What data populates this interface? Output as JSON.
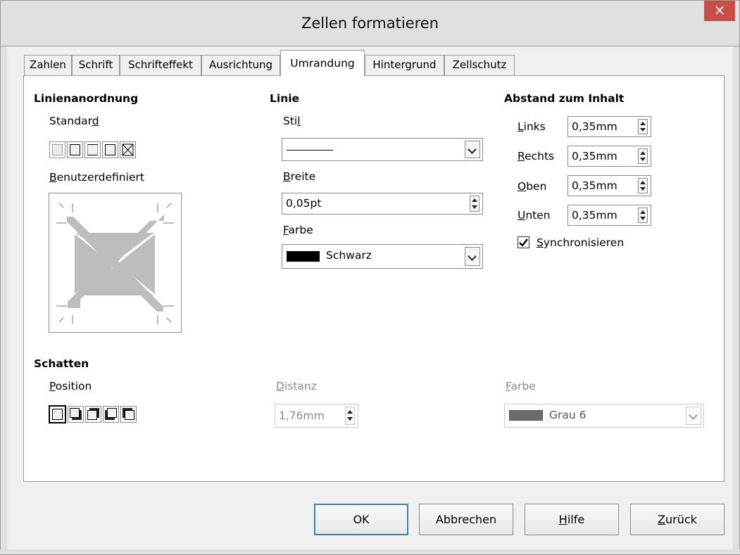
{
  "window": {
    "title": "Zellen formatieren",
    "close_glyph": "×"
  },
  "tabs": [
    {
      "label": "Zahlen",
      "active": false
    },
    {
      "label": "Schrift",
      "active": false
    },
    {
      "label": "Schrifteffekt",
      "active": false
    },
    {
      "label": "Ausrichtung",
      "active": false
    },
    {
      "label": "Umrandung",
      "active": true
    },
    {
      "label": "Hintergrund",
      "active": false
    },
    {
      "label": "Zellschutz",
      "active": false
    }
  ],
  "line_arrangement": {
    "heading": "Linienanordnung",
    "default_label_pre": "Standar",
    "default_label_key": "d",
    "user_defined_label_pre": "",
    "user_defined_label_key": "B",
    "user_defined_label_post": "enutzerdefiniert",
    "presets": [
      "no-border-icon",
      "outer-border-icon",
      "outer-horizontal-icon",
      "outer-inner-icon",
      "diagonal-cross-icon"
    ]
  },
  "line": {
    "heading": "Linie",
    "style_label_pre": "Sti",
    "style_label_key": "l",
    "width_label_pre": "",
    "width_label_key": "B",
    "width_label_post": "reite",
    "width_value": "0,05pt",
    "color_label_pre": "",
    "color_label_key": "F",
    "color_label_post": "arbe",
    "color_value": "Schwarz",
    "color_swatch": "#000000"
  },
  "spacing": {
    "heading": "Abstand zum Inhalt",
    "rows": [
      {
        "key": "L",
        "rest": "inks",
        "value": "0,35mm"
      },
      {
        "key": "R",
        "rest": "echts",
        "value": "0,35mm"
      },
      {
        "key": "O",
        "rest": "ben",
        "value": "0,35mm"
      },
      {
        "key": "U",
        "rest": "nten",
        "value": "0,35mm"
      }
    ],
    "sync_key": "S",
    "sync_rest": "ynchronisieren",
    "sync_checked": true
  },
  "shadow": {
    "heading": "Schatten",
    "position_key": "P",
    "position_rest": "osition",
    "distance_key": "D",
    "distance_rest": "istanz",
    "distance_value": "1,76mm",
    "color_key": "F",
    "color_rest": "arbe",
    "color_value": "Grau 6",
    "color_swatch": "#6b6b6b",
    "presets": [
      "no-shadow-icon",
      "shadow-bottom-right-icon",
      "shadow-top-right-icon",
      "shadow-bottom-left-icon",
      "shadow-top-left-icon"
    ]
  },
  "buttons": {
    "ok": "OK",
    "cancel": "Abbrechen",
    "help_key": "H",
    "help_rest": "ilfe",
    "reset_key": "Z",
    "reset_rest": "urück"
  }
}
